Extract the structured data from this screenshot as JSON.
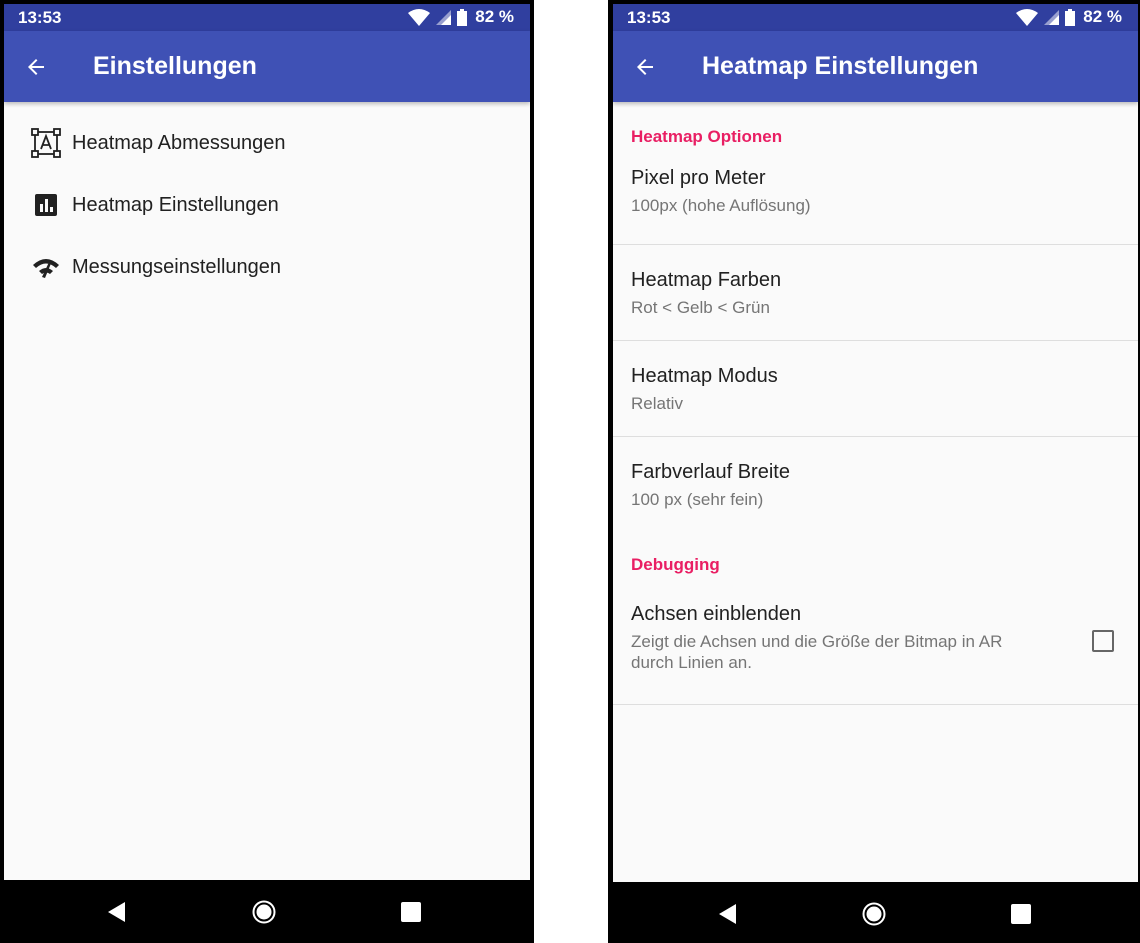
{
  "left_screen": {
    "status": {
      "time": "13:53",
      "battery": "82 %"
    },
    "appbar": {
      "title": "Einstellungen"
    },
    "menu_items": [
      {
        "label": "Heatmap Abmessungen",
        "icon": "dimensions-icon"
      },
      {
        "label": "Heatmap Einstellungen",
        "icon": "bar-chart-icon"
      },
      {
        "label": "Messungseinstellungen",
        "icon": "network-check-icon"
      }
    ]
  },
  "right_screen": {
    "status": {
      "time": "13:53",
      "battery": "82 %"
    },
    "appbar": {
      "title": "Heatmap Einstellungen"
    },
    "sections": [
      {
        "header": "Heatmap Optionen",
        "prefs": [
          {
            "title": "Pixel pro Meter",
            "summary": "100px (hohe Auflösung)"
          },
          {
            "title": "Heatmap Farben",
            "summary": "Rot < Gelb < Grün"
          },
          {
            "title": "Heatmap Modus",
            "summary": "Relativ"
          },
          {
            "title": "Farbverlauf Breite",
            "summary": "100 px (sehr fein)"
          }
        ]
      },
      {
        "header": "Debugging",
        "prefs": [
          {
            "title": "Achsen einblenden",
            "summary": "Zeigt die Achsen und die Größe der Bitmap in AR durch Linien an.",
            "checked": false
          }
        ]
      }
    ]
  },
  "colors": {
    "primary": "#3f51b5",
    "primary_dark": "#303f9f",
    "accent": "#e91e63",
    "background": "#fafafa"
  }
}
